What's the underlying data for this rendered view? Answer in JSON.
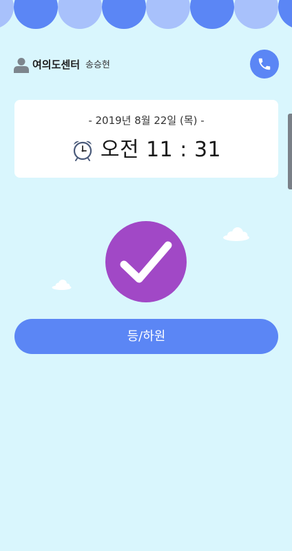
{
  "header": {
    "center_name": "여의도센터",
    "user_name": "송승현"
  },
  "card": {
    "date": "- 2019년 8월 22일 (목) -",
    "time": "오전 11 : 31"
  },
  "main": {
    "attend_button_label": "등/하원"
  },
  "colors": {
    "background": "#d9f6fd",
    "awning_dark": "#5b86f5",
    "awning_light": "#a8c1fb",
    "accent": "#5b86f5",
    "check_circle": "#a148c6"
  },
  "icons": [
    "user-icon",
    "phone-icon",
    "alarm-clock-icon",
    "checkmark-icon",
    "cloud-icon"
  ]
}
